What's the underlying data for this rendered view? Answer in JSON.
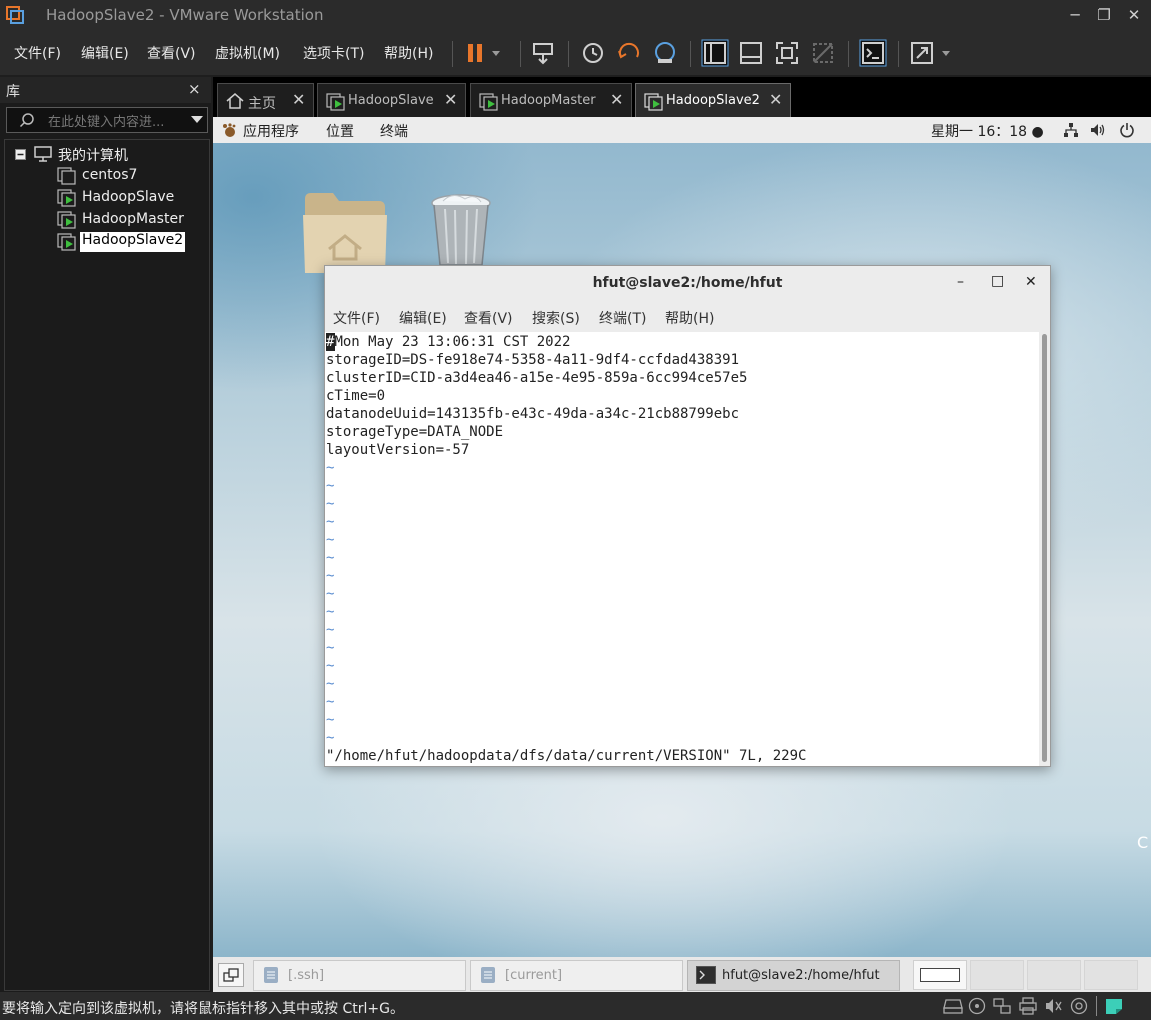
{
  "window": {
    "title": "HadoopSlave2 - VMware Workstation",
    "controls": {
      "minimize": "─",
      "restore": "❐",
      "close": "✕"
    }
  },
  "menubar": {
    "items": [
      "文件(F)",
      "编辑(E)",
      "查看(V)",
      "虚拟机(M)",
      "选项卡(T)",
      "帮助(H)"
    ]
  },
  "library": {
    "title": "库",
    "close": "×",
    "search_placeholder": "在此处键入内容进...",
    "root": "我的计算机",
    "vms": [
      "centos7",
      "HadoopSlave",
      "HadoopMaster",
      "HadoopSlave2"
    ],
    "selected_vm": "HadoopSlave2"
  },
  "tabs": [
    {
      "label": "主页",
      "close": "✕"
    },
    {
      "label": "HadoopSlave",
      "close": "✕"
    },
    {
      "label": "HadoopMaster",
      "close": "✕"
    },
    {
      "label": "HadoopSlave2",
      "close": "✕",
      "active": true
    }
  ],
  "guest": {
    "panel": {
      "apps": "应用程序",
      "places": "位置",
      "terminal": "终端",
      "clock": "星期一 16：18 ●"
    },
    "terminal_window": {
      "title": "hfut@slave2:/home/hfut",
      "controls": {
        "minimize": "–",
        "maximize": "□",
        "close": "✕"
      },
      "menu": [
        "文件(F)",
        "编辑(E)",
        "查看(V)",
        "搜索(S)",
        "终端(T)",
        "帮助(H)"
      ],
      "lines": [
        "#Mon May 23 13:06:31 CST 2022",
        "storageID=DS-fe918e74-5358-4a11-9df4-ccfdad438391",
        "clusterID=CID-a3d4ea46-a15e-4e95-859a-6cc994ce57e5",
        "cTime=0",
        "datanodeUuid=143135fb-e43c-49da-a34c-21cb88799ebc",
        "storageType=DATA_NODE",
        "layoutVersion=-57"
      ],
      "tilde_count": 16,
      "tilde": "~",
      "status_line": "\"/home/hfut/hadoopdata/dfs/data/current/VERSION\" 7L, 229C"
    },
    "desktop_trailing_char": "C",
    "taskbar": {
      "items": [
        "[.ssh]",
        "[current]",
        "hfut@slave2:/home/hfut"
      ]
    }
  },
  "statusbar": {
    "text": "要将输入定向到该虚拟机，请将鼠标指针移入其中或按 Ctrl+G。"
  },
  "colors": {
    "accent_orange": "#e8762b",
    "play_green": "#3fbf3f",
    "tilde_blue": "#5b8ed0"
  }
}
